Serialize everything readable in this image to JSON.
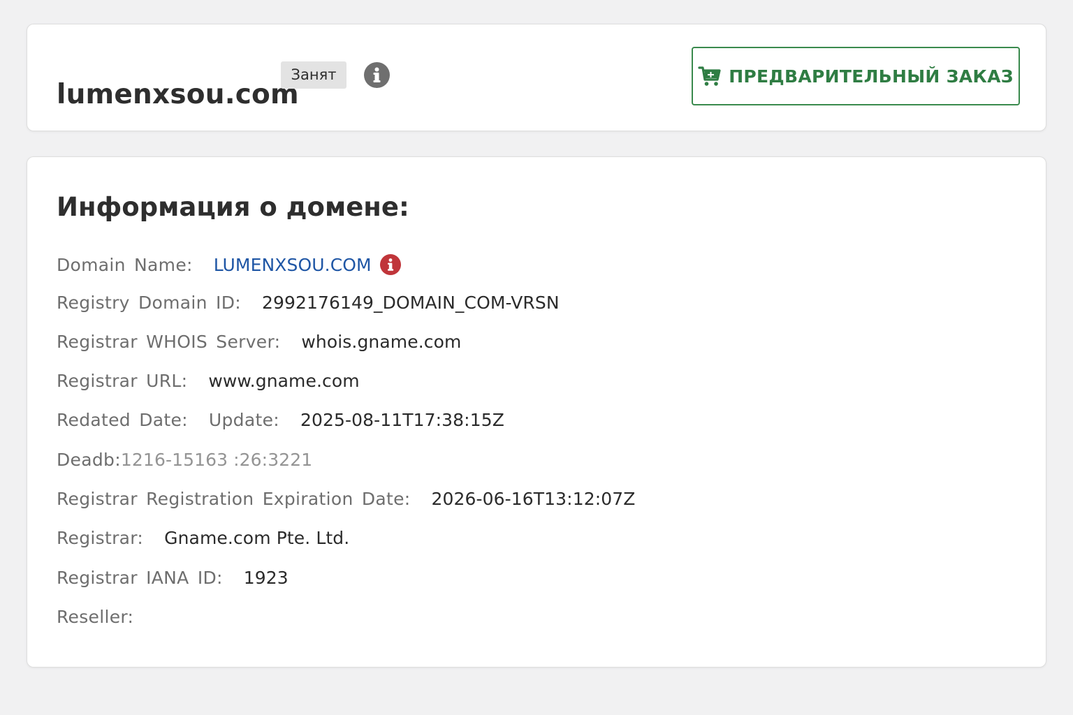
{
  "header": {
    "domain": "lumenxsou.com",
    "status_badge": "Занят",
    "info_icon": "info-circle-icon",
    "preorder_button": {
      "label": "ПРЕДВАРИТЕЛЬНЫЙ ЗАКАЗ",
      "icon": "shopping-cart-icon"
    }
  },
  "info": {
    "heading": "Информация о домене:",
    "rows": [
      {
        "label": "Domain Name:",
        "value": "LUMENXSOU.COM"
      },
      {
        "label": "Registry Domain ID:",
        "value": "2992176149_DOMAIN_COM-VRSN"
      },
      {
        "label": "Registrar WHOIS Server:",
        "value": "whois.gname.com"
      },
      {
        "label": "Registrar URL:",
        "value": "www.gname.com"
      },
      {
        "label": "Redated Date:",
        "value": "Update:",
        "value2": "2025-08-11T17:38:15Z"
      },
      {
        "label": "Deadb:",
        "value": "1216-15163 :26:3221"
      },
      {
        "label": "Registrar Registration Expiration Date:",
        "value": "2026-06-16T13:12:07Z"
      },
      {
        "label": "Registrar:",
        "value": "Gname.com Pte. Ltd."
      },
      {
        "label": "Registrar IANA ID:",
        "value": "1923"
      },
      {
        "label": "Reseller:",
        "value": ""
      }
    ]
  },
  "colors": {
    "background": "#f1f1f2",
    "card": "#ffffff",
    "accent_green": "#2f7d43",
    "link_blue": "#1f56a5",
    "alert_red": "#c0353a",
    "badge_gray": "#e3e3e3",
    "icon_gray": "#6f6f6f"
  }
}
